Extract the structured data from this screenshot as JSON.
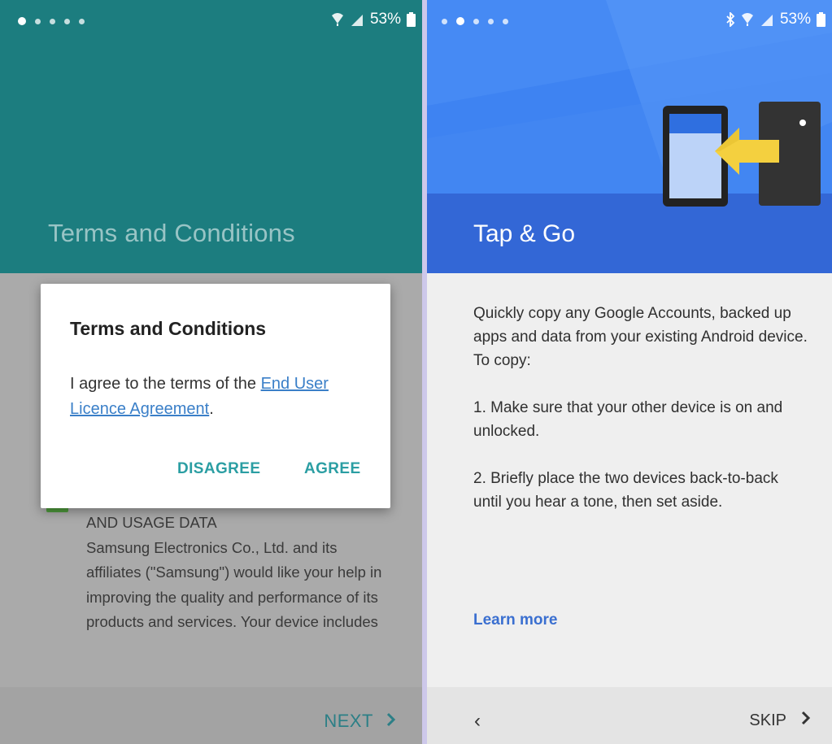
{
  "left_screen": {
    "status_bar": {
      "battery": "53%",
      "icons": [
        "wifi-icon",
        "signal-icon",
        "battery-icon"
      ]
    },
    "header_title": "Terms and Conditions",
    "dialog": {
      "title": "Terms and Conditions",
      "message_prefix": "I agree to the terms of the ",
      "link_text": "End User Licence Agreement",
      "message_suffix": ".",
      "disagree_label": "DISAGREE",
      "agree_label": "AGREE"
    },
    "usage_data": {
      "heading": "AND USAGE DATA",
      "body": "Samsung Electronics Co., Ltd. and its affiliates (\"Samsung\") would like your help in improving the quality and performance of its products and services. Your device includes"
    },
    "next_label": "NEXT"
  },
  "right_screen": {
    "status_bar": {
      "battery": "53%",
      "icons": [
        "bluetooth-icon",
        "wifi-icon",
        "signal-icon",
        "battery-icon"
      ]
    },
    "header_title": "Tap & Go",
    "intro": "Quickly copy any Google Accounts, backed up apps and data from your existing Android device. To copy:",
    "step1": "1. Make sure that your other device is on and unlocked.",
    "step2": "2. Briefly place the two devices back-to-back until you hear a tone, then set aside.",
    "learn_more": "Learn more",
    "back_label": "‹",
    "skip_label": "SKIP"
  },
  "colors": {
    "teal_header": "#1c7d7f",
    "blue_header": "#3e83f2",
    "accent_teal": "#2b9ea3",
    "link_blue": "#3a6fd0",
    "checkbox_green": "#4e9a3c"
  }
}
